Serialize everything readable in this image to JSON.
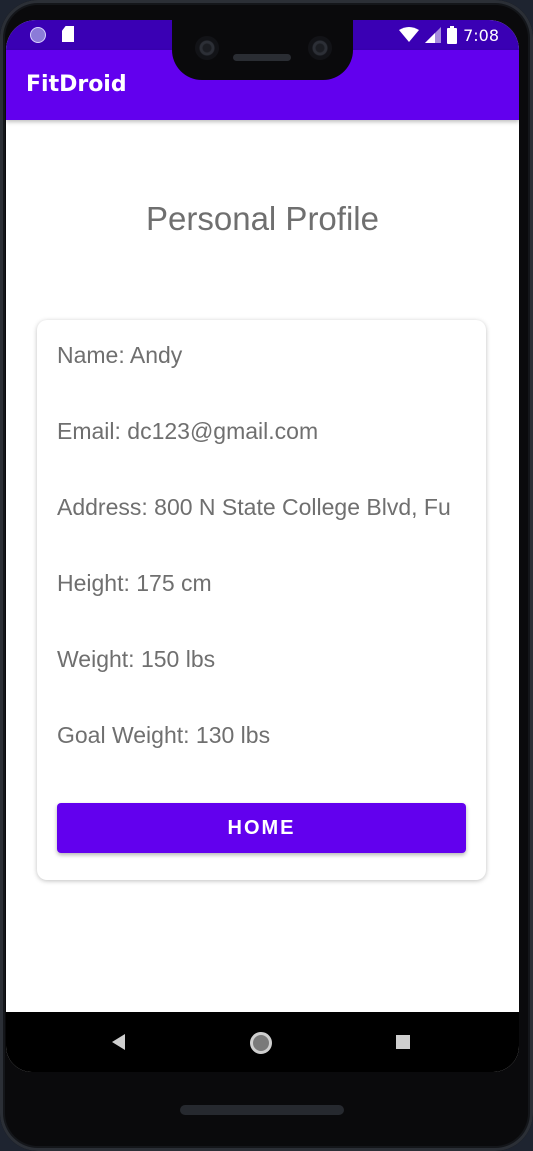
{
  "status_bar": {
    "time": "7:08"
  },
  "app_bar": {
    "title": "FitDroid"
  },
  "page": {
    "title": "Personal Profile"
  },
  "profile": {
    "name": "Name: Andy",
    "email": "Email: dc123@gmail.com",
    "address": "Address: 800 N State College Blvd, Fu",
    "height": "Height: 175 cm",
    "weight": "Weight: 150 lbs",
    "goal_weight": "Goal Weight: 130 lbs"
  },
  "actions": {
    "home_label": "HOME"
  },
  "colors": {
    "primary": "#6200ee",
    "primary_dark": "#3a00b4",
    "text": "#6f6f6f"
  },
  "icons": {
    "status": [
      "notification-dot-icon",
      "sd-card-icon",
      "wifi-icon",
      "cell-signal-icon",
      "battery-icon"
    ],
    "nav": [
      "back-icon",
      "home-icon",
      "recents-icon"
    ]
  }
}
